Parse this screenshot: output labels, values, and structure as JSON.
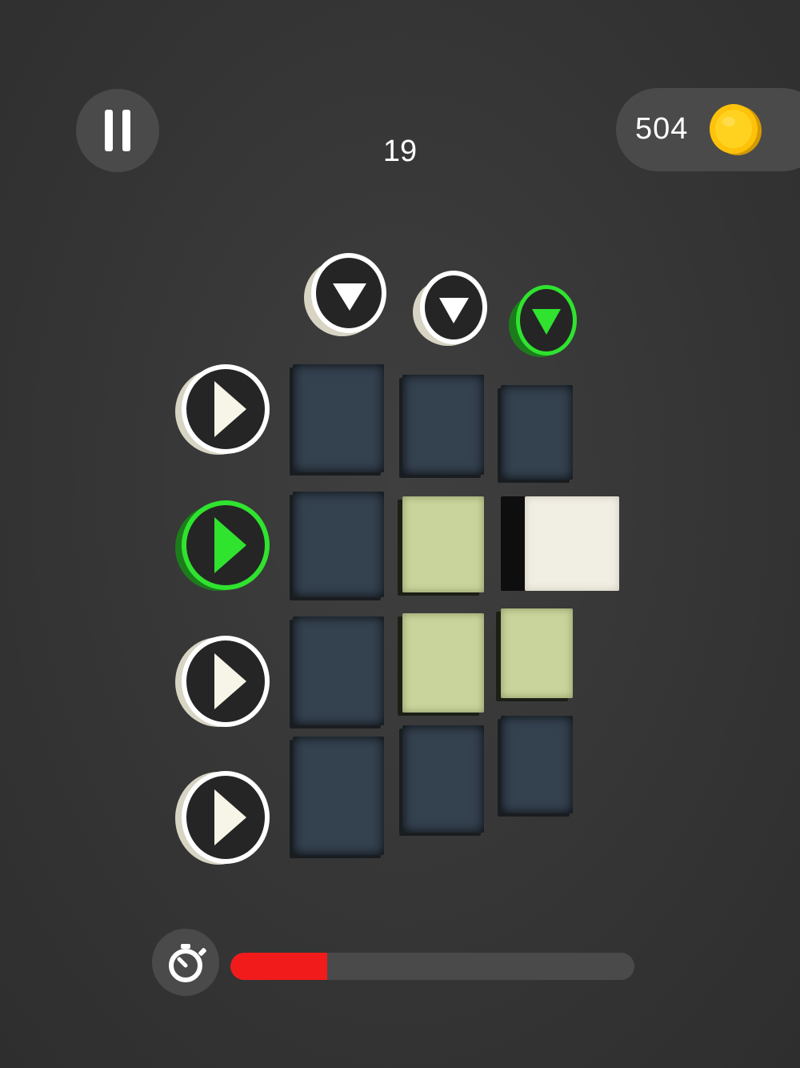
{
  "hud": {
    "level": "19",
    "coins": "504"
  },
  "icons": {
    "pause": "pause-icon",
    "coin": "coin-icon",
    "timer": "stopwatch-icon",
    "row_button": "play-right-icon",
    "column_button": "play-down-icon"
  },
  "colors": {
    "background": "#363636",
    "hud_pill": "#4a4a4a",
    "tile_off": "#34414f",
    "tile_on": "#c9d49c",
    "tile_white": "#f1eee4",
    "active_green": "#2fe32f",
    "timer_fill": "#f11b1b"
  },
  "columns": [
    {
      "active": false
    },
    {
      "active": false
    },
    {
      "active": true
    }
  ],
  "rows": [
    {
      "active": false
    },
    {
      "active": true
    },
    {
      "active": false
    },
    {
      "active": false
    }
  ],
  "grid": [
    [
      "off",
      "off",
      "off"
    ],
    [
      "off",
      "on",
      "white"
    ],
    [
      "off",
      "on",
      "on"
    ],
    [
      "off",
      "off",
      "off"
    ]
  ],
  "timer": {
    "progress": 0.24
  }
}
